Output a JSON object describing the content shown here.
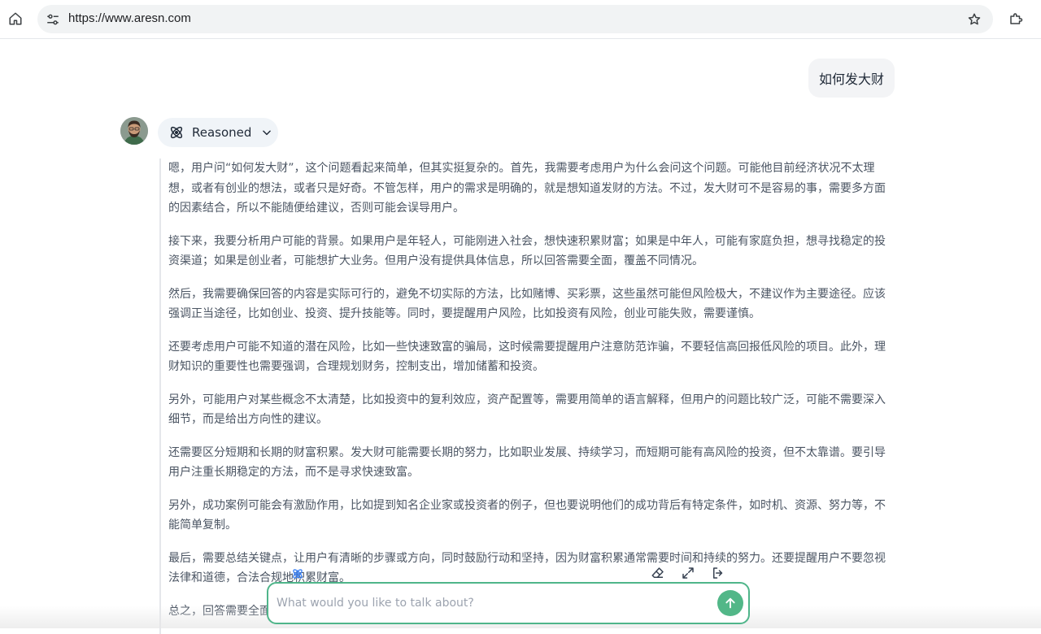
{
  "browser": {
    "url": "https://www.aresn.com"
  },
  "chat": {
    "user_message": "如何发大财",
    "reasoned_label": "Reasoned",
    "reasoning_paragraphs": [
      "嗯，用户问“如何发大财”，这个问题看起来简单，但其实挺复杂的。首先，我需要考虑用户为什么会问这个问题。可能他目前经济状况不太理想，或者有创业的想法，或者只是好奇。不管怎样，用户的需求是明确的，就是想知道发财的方法。不过，发大财可不是容易的事，需要多方面的因素结合，所以不能随便给建议，否则可能会误导用户。",
      "接下来，我要分析用户可能的背景。如果用户是年轻人，可能刚进入社会，想快速积累财富；如果是中年人，可能有家庭负担，想寻找稳定的投资渠道；如果是创业者，可能想扩大业务。但用户没有提供具体信息，所以回答需要全面，覆盖不同情况。",
      "然后，我需要确保回答的内容是实际可行的，避免不切实际的方法，比如赌博、买彩票，这些虽然可能但风险极大，不建议作为主要途径。应该强调正当途径，比如创业、投资、提升技能等。同时，要提醒用户风险，比如投资有风险，创业可能失败，需要谨慎。",
      "还要考虑用户可能不知道的潜在风险，比如一些快速致富的骗局，这时候需要提醒用户注意防范诈骗，不要轻信高回报低风险的项目。此外，理财知识的重要性也需要强调，合理规划财务，控制支出，增加储蓄和投资。",
      "另外，可能用户对某些概念不太清楚，比如投资中的复利效应，资产配置等，需要用简单的语言解释，但用户的问题比较广泛，可能不需要深入细节，而是给出方向性的建议。",
      "还需要区分短期和长期的财富积累。发大财可能需要长期的努力，比如职业发展、持续学习，而短期可能有高风险的投资，但不太靠谱。要引导用户注重长期稳定的方法，而不是寻求快速致富。",
      "另外，成功案例可能会有激励作用，比如提到知名企业家或投资者的例子，但也要说明他们的成功背后有特定条件，如时机、资源、努力等，不能简单复制。",
      "最后，需要总结关键点，让用户有清晰的步骤或方向，同时鼓励行动和坚持，因为财富积累通常需要时间和持续的努力。还要提醒用户不要忽视法律和道德，合法合规地积累财富。",
      "总之，回答需要全面，既要给出可行的方法，也要提醒风险，引导用户树立正确的财富观念，做出理性的选择。"
    ]
  },
  "composer": {
    "placeholder": "What would you like to talk about?",
    "value": ""
  },
  "icons": {
    "home": "home-icon",
    "site_settings": "tune-icon",
    "bookmark": "star-icon",
    "extensions": "puzzle-icon",
    "reasoned": "atom-icon",
    "expand": "chevron-down-icon",
    "clear": "eraser-icon",
    "fullscreen": "expand-icon",
    "exit": "logout-icon",
    "send": "arrow-up-icon"
  },
  "colors": {
    "accent": "#52b788",
    "composer_border": "#4fb58a",
    "user_bubble": "#f3f4f6",
    "reasoned_chip": "#f0f4f8"
  }
}
